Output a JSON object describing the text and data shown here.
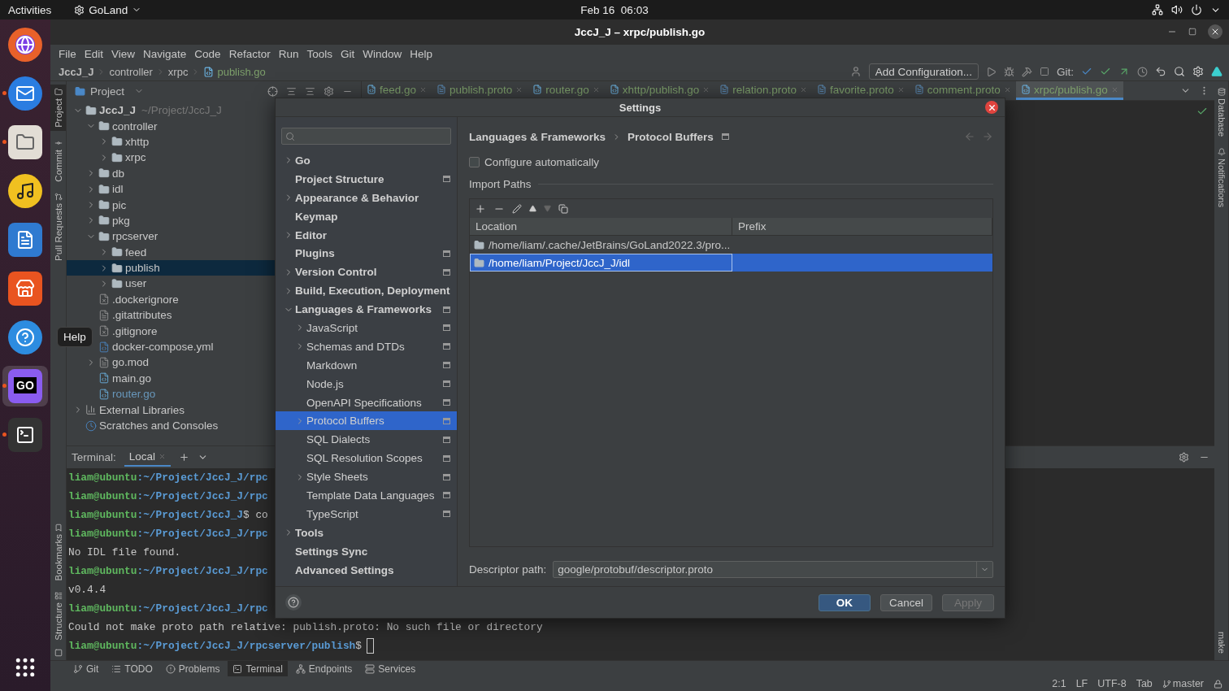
{
  "top_bar": {
    "activities": "Activities",
    "app": "GoLand",
    "clock": "Feb 16  06:03"
  },
  "dock": [
    {
      "kind": "browser",
      "running": false,
      "selected": false
    },
    {
      "kind": "mail",
      "running": true,
      "selected": false
    },
    {
      "kind": "files",
      "running": true,
      "selected": false
    },
    {
      "kind": "music",
      "running": false,
      "selected": false
    },
    {
      "kind": "document",
      "running": false,
      "selected": false
    },
    {
      "kind": "store",
      "running": false,
      "selected": false
    },
    {
      "kind": "help",
      "running": false,
      "selected": false
    },
    {
      "kind": "ide",
      "label": "GO",
      "running": true,
      "selected": true
    },
    {
      "kind": "terminal",
      "running": true,
      "selected": false
    }
  ],
  "tooltip": "Help",
  "window": {
    "title": "JccJ_J – xrpc/publish.go"
  },
  "menu": [
    "File",
    "Edit",
    "View",
    "Navigate",
    "Code",
    "Refactor",
    "Run",
    "Tools",
    "Git",
    "Window",
    "Help"
  ],
  "breadcrumb": [
    {
      "label": "JccJ_J",
      "kind": "project"
    },
    {
      "label": "controller",
      "kind": "folder"
    },
    {
      "label": "xrpc",
      "kind": "folder"
    },
    {
      "label": "publish.go",
      "kind": "file"
    }
  ],
  "toolbar": {
    "run_config": "Add Configuration...",
    "git_label": "Git:"
  },
  "left_stripe": [
    {
      "label": "Project",
      "selected": true
    },
    {
      "label": "Commit",
      "selected": false
    },
    {
      "label": "Pull Requests",
      "selected": false
    }
  ],
  "left_stripe_bottom": [
    "Bookmarks",
    "Structure"
  ],
  "right_stripe": [
    "Database",
    "Notifications"
  ],
  "right_stripe_bottom": [
    "make"
  ],
  "project_panel": {
    "title": "Project",
    "tree": [
      {
        "label": "JccJ_J",
        "note": "~/Project/JccJ_J",
        "kind": "root",
        "expanded": true,
        "selected": false,
        "changed": false,
        "children": [
          {
            "label": "controller",
            "kind": "folder",
            "expanded": true,
            "selected": false,
            "changed": false,
            "children": [
              {
                "label": "xhttp",
                "kind": "folder",
                "expanded": false,
                "selected": false,
                "changed": false
              },
              {
                "label": "xrpc",
                "kind": "folder",
                "expanded": false,
                "selected": false,
                "changed": false
              }
            ]
          },
          {
            "label": "db",
            "kind": "folder",
            "expanded": false,
            "selected": false,
            "changed": false
          },
          {
            "label": "idl",
            "kind": "folder",
            "expanded": false,
            "selected": false,
            "changed": false
          },
          {
            "label": "pic",
            "kind": "folder",
            "expanded": false,
            "selected": false,
            "changed": false
          },
          {
            "label": "pkg",
            "kind": "folder",
            "expanded": false,
            "selected": false,
            "changed": false
          },
          {
            "label": "rpcserver",
            "kind": "folder",
            "expanded": true,
            "selected": false,
            "changed": false,
            "children": [
              {
                "label": "feed",
                "kind": "folder",
                "expanded": false,
                "selected": false,
                "changed": false
              },
              {
                "label": "publish",
                "kind": "folder",
                "expanded": false,
                "selected": true,
                "changed": false
              },
              {
                "label": "user",
                "kind": "folder",
                "expanded": false,
                "selected": false,
                "changed": false
              }
            ]
          },
          {
            "label": ".dockerignore",
            "kind": "ignore",
            "selected": false,
            "changed": false
          },
          {
            "label": ".gitattributes",
            "kind": "text",
            "selected": false,
            "changed": false
          },
          {
            "label": ".gitignore",
            "kind": "ignore",
            "selected": false,
            "changed": false
          },
          {
            "label": "docker-compose.yml",
            "kind": "yaml",
            "selected": false,
            "changed": false
          },
          {
            "label": "go.mod",
            "kind": "mod",
            "expanded": false,
            "selected": false,
            "changed": false
          },
          {
            "label": "main.go",
            "kind": "go",
            "selected": false,
            "changed": false
          },
          {
            "label": "router.go",
            "kind": "go",
            "selected": false,
            "changed": true
          }
        ]
      },
      {
        "label": "External Libraries",
        "kind": "libraries",
        "expanded": false,
        "selected": false,
        "changed": false
      },
      {
        "label": "Scratches and Consoles",
        "kind": "scratches",
        "selected": false,
        "changed": false
      }
    ]
  },
  "editor_tabs": [
    {
      "label": "feed.go",
      "kind": "go",
      "selected": false
    },
    {
      "label": "publish.proto",
      "kind": "proto",
      "selected": false
    },
    {
      "label": "router.go",
      "kind": "go",
      "selected": false
    },
    {
      "label": "xhttp/publish.go",
      "kind": "go",
      "selected": false
    },
    {
      "label": "relation.proto",
      "kind": "proto",
      "selected": false
    },
    {
      "label": "favorite.proto",
      "kind": "proto",
      "selected": false
    },
    {
      "label": "comment.proto",
      "kind": "proto",
      "selected": false
    },
    {
      "label": "xrpc/publish.go",
      "kind": "go",
      "selected": true
    }
  ],
  "terminal": {
    "title": "Terminal:",
    "tabs": [
      {
        "label": "Local",
        "selected": true
      }
    ],
    "lines": [
      {
        "kind": "prompt",
        "user": "liam@ubuntu",
        "path": ":~/Project/JccJ_J/rpc"
      },
      {
        "kind": "prompt",
        "user": "liam@ubuntu",
        "path": ":~/Project/JccJ_J/rpc"
      },
      {
        "kind": "prompt",
        "user": "liam@ubuntu",
        "path": ":~/Project/JccJ_J",
        "command": "$ co"
      },
      {
        "kind": "prompt",
        "user": "liam@ubuntu",
        "path": ":~/Project/JccJ_J/rpc"
      },
      {
        "kind": "output",
        "text": "No IDL file found."
      },
      {
        "kind": "prompt",
        "user": "liam@ubuntu",
        "path": ":~/Project/JccJ_J/rpc"
      },
      {
        "kind": "output",
        "text": "v0.4.4"
      },
      {
        "kind": "prompt",
        "user": "liam@ubuntu",
        "path": ":~/Project/JccJ_J/rpc"
      },
      {
        "kind": "output",
        "text": "Could not make proto path relative: publish.proto: No such file or directory"
      },
      {
        "kind": "prompt",
        "user": "liam@ubuntu",
        "path": ":~/Project/JccJ_J/rpcserver/publish",
        "command": "$",
        "cursor": true
      }
    ]
  },
  "tool_tabs": [
    {
      "label": "Git",
      "kind": "git",
      "selected": false
    },
    {
      "label": "TODO",
      "kind": "todo",
      "selected": false
    },
    {
      "label": "Problems",
      "kind": "problems",
      "selected": false
    },
    {
      "label": "Terminal",
      "kind": "terminal",
      "selected": true
    },
    {
      "label": "Endpoints",
      "kind": "endpoints",
      "selected": false
    },
    {
      "label": "Services",
      "kind": "services",
      "selected": false
    }
  ],
  "status_bar": [
    "2:1",
    "LF",
    "UTF-8",
    "Tab",
    "master"
  ],
  "settings": {
    "title": "Settings",
    "nav": [
      {
        "label": "Go",
        "kind": "node",
        "expanded": false,
        "selected": false,
        "project_scoped": false
      },
      {
        "label": "Project Structure",
        "kind": "leaf",
        "selected": false,
        "project_scoped": true
      },
      {
        "label": "Appearance & Behavior",
        "kind": "node",
        "expanded": false,
        "selected": false,
        "project_scoped": false
      },
      {
        "label": "Keymap",
        "kind": "leaf",
        "selected": false,
        "project_scoped": false
      },
      {
        "label": "Editor",
        "kind": "node",
        "expanded": false,
        "selected": false,
        "project_scoped": false
      },
      {
        "label": "Plugins",
        "kind": "leaf",
        "selected": false,
        "project_scoped": true
      },
      {
        "label": "Version Control",
        "kind": "node",
        "expanded": false,
        "selected": false,
        "project_scoped": true
      },
      {
        "label": "Build, Execution, Deployment",
        "kind": "node",
        "expanded": false,
        "selected": false,
        "project_scoped": false
      },
      {
        "label": "Languages & Frameworks",
        "kind": "node",
        "expanded": true,
        "selected": false,
        "project_scoped": true,
        "children": [
          {
            "label": "JavaScript",
            "kind": "node",
            "expanded": false,
            "selected": false,
            "project_scoped": true
          },
          {
            "label": "Schemas and DTDs",
            "kind": "node",
            "expanded": false,
            "selected": false,
            "project_scoped": true
          },
          {
            "label": "Markdown",
            "kind": "leaf",
            "selected": false,
            "project_scoped": true
          },
          {
            "label": "Node.js",
            "kind": "leaf",
            "selected": false,
            "project_scoped": true
          },
          {
            "label": "OpenAPI Specifications",
            "kind": "leaf",
            "selected": false,
            "project_scoped": true
          },
          {
            "label": "Protocol Buffers",
            "kind": "node",
            "expanded": false,
            "selected": true,
            "project_scoped": true
          },
          {
            "label": "SQL Dialects",
            "kind": "leaf",
            "selected": false,
            "project_scoped": true
          },
          {
            "label": "SQL Resolution Scopes",
            "kind": "leaf",
            "selected": false,
            "project_scoped": true
          },
          {
            "label": "Style Sheets",
            "kind": "node",
            "expanded": false,
            "selected": false,
            "project_scoped": true
          },
          {
            "label": "Template Data Languages",
            "kind": "leaf",
            "selected": false,
            "project_scoped": true
          },
          {
            "label": "TypeScript",
            "kind": "leaf",
            "selected": false,
            "project_scoped": true
          }
        ]
      },
      {
        "label": "Tools",
        "kind": "node",
        "expanded": false,
        "selected": false,
        "project_scoped": false
      },
      {
        "label": "Settings Sync",
        "kind": "leaf",
        "selected": false,
        "project_scoped": false
      },
      {
        "label": "Advanced Settings",
        "kind": "leaf",
        "selected": false,
        "project_scoped": false
      }
    ],
    "breadcrumb": [
      "Languages & Frameworks",
      "Protocol Buffers"
    ],
    "configure_automatically": {
      "label": "Configure automatically",
      "checked": false
    },
    "import_paths": {
      "title": "Import Paths",
      "columns": [
        "Location",
        "Prefix"
      ],
      "rows": [
        {
          "location": "/home/liam/.cache/JetBrains/GoLand2022.3/pro...",
          "selected": false
        },
        {
          "location": "/home/liam/Project/JccJ_J/idl",
          "selected": true
        }
      ]
    },
    "descriptor": {
      "label": "Descriptor path:",
      "value": "google/protobuf/descriptor.proto"
    },
    "buttons": [
      {
        "label": "OK",
        "default": true,
        "disabled": false
      },
      {
        "label": "Cancel",
        "default": false,
        "disabled": false
      },
      {
        "label": "Apply",
        "default": false,
        "disabled": true
      }
    ]
  }
}
